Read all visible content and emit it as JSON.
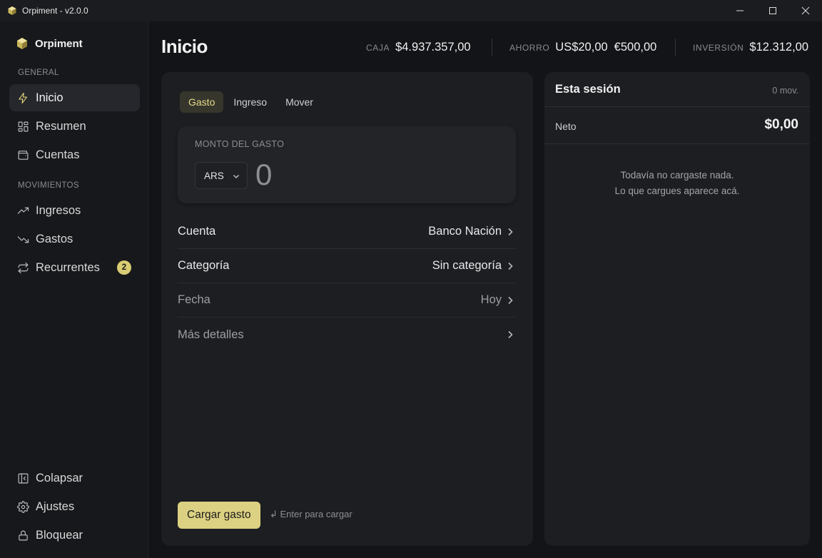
{
  "window": {
    "title": "Orpiment - v2.0.0"
  },
  "sidebar": {
    "brand": "Orpiment",
    "section_general": "GENERAL",
    "section_movements": "MOVIMIENTOS",
    "items": [
      {
        "label": "Inicio",
        "icon": "bolt-icon",
        "active": true
      },
      {
        "label": "Resumen",
        "icon": "grid-icon"
      },
      {
        "label": "Cuentas",
        "icon": "wallet-icon"
      },
      {
        "label": "Ingresos",
        "icon": "trending-up-icon"
      },
      {
        "label": "Gastos",
        "icon": "trending-down-icon"
      },
      {
        "label": "Recurrentes",
        "icon": "repeat-icon",
        "badge": "2"
      }
    ],
    "bottom": [
      {
        "label": "Colapsar",
        "icon": "collapse-icon"
      },
      {
        "label": "Ajustes",
        "icon": "gear-icon"
      },
      {
        "label": "Bloquear",
        "icon": "lock-icon"
      }
    ]
  },
  "header": {
    "title": "Inicio",
    "caja_label": "CAJA",
    "caja_value": "$4.937.357,00",
    "ahorro_label": "AHORRO",
    "ahorro_usd": "US$20,00",
    "ahorro_eur": "€500,00",
    "inversion_label": "INVERSIÓN",
    "inversion_value": "$12.312,00"
  },
  "form": {
    "tabs": [
      "Gasto",
      "Ingreso",
      "Mover"
    ],
    "active_tab": "Gasto",
    "amount_label": "MONTO DEL GASTO",
    "currency": "ARS",
    "amount": "0",
    "rows": [
      {
        "label": "Cuenta",
        "value": "Banco Nación"
      },
      {
        "label": "Categoría",
        "value": "Sin categoría"
      },
      {
        "label": "Fecha",
        "value": "Hoy"
      },
      {
        "label": "Más detalles",
        "value": ""
      }
    ],
    "submit_label": "Cargar gasto",
    "hint": "↲ Enter para cargar"
  },
  "session": {
    "title": "Esta sesión",
    "count": "0 mov.",
    "net_label": "Neto",
    "net_value": "$0,00",
    "empty_line1": "Todavía no cargaste nada.",
    "empty_line2": "Lo que cargues aparece acá."
  },
  "colors": {
    "accent": "#dcd182",
    "background": "#131417",
    "card": "#1d1e22"
  }
}
